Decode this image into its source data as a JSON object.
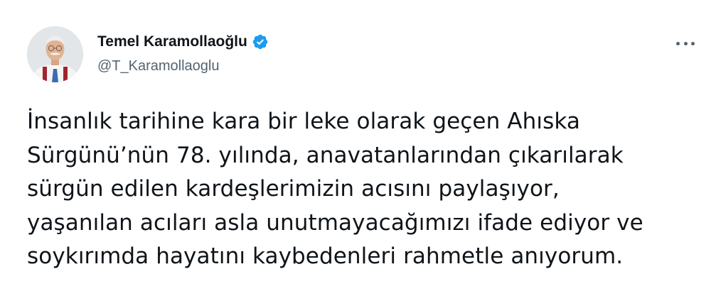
{
  "author": {
    "display_name": "Temel Karamollaoğlu",
    "handle": "@T_Karamollaoglu",
    "verified": true,
    "avatar_icon": "profile-photo"
  },
  "menu": {
    "icon": "more-horizontal-icon"
  },
  "tweet": {
    "text": "İnsanlık tarihine kara bir leke olarak geçen Ahıska\nSürgünü’nün 78. yılında, anavatanlarından çıkarılarak\nsürgün edilen kardeşlerimizin acısını paylaşıyor,\nyaşanılan acıları asla unutmayacağımızı ifade ediyor ve\nsoykırımda hayatını kaybedenleri rahmetle anıyorum."
  },
  "colors": {
    "text_primary": "#0f1419",
    "text_secondary": "#536471",
    "verified_blue": "#1d9bf0",
    "background": "#ffffff"
  }
}
